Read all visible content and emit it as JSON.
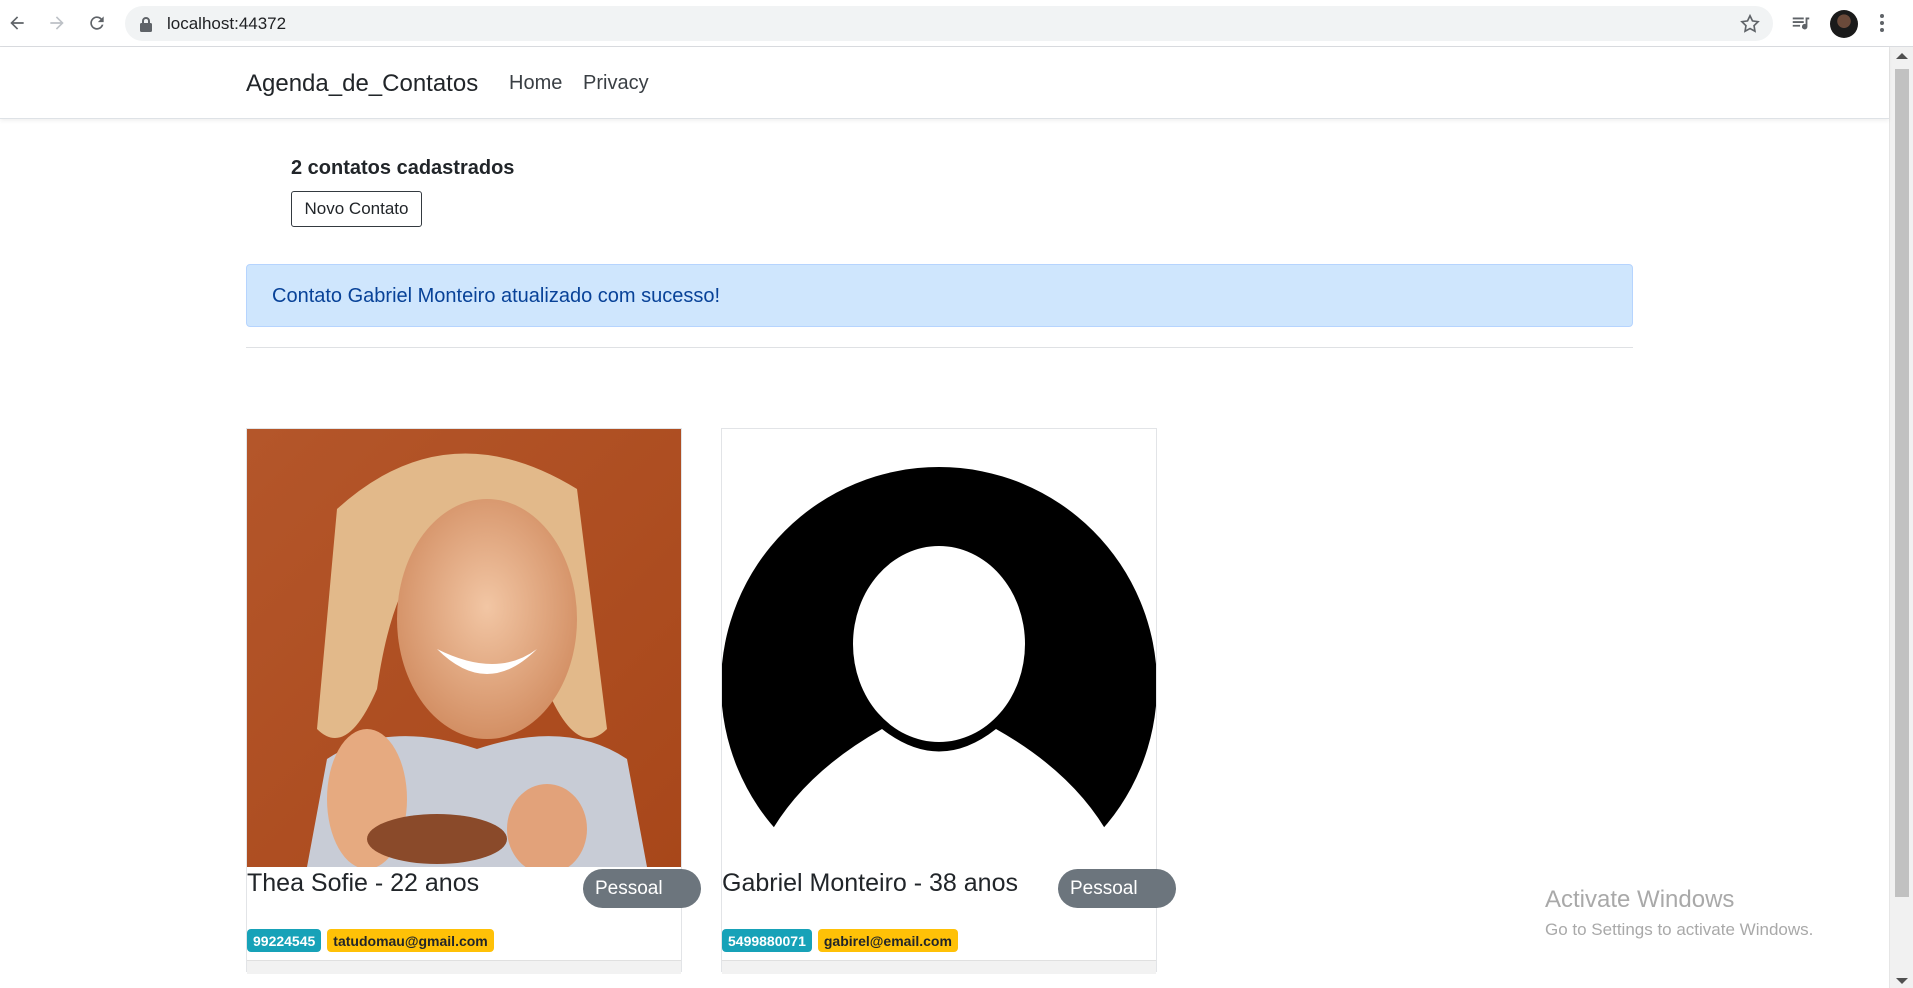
{
  "browser": {
    "url": "localhost:44372"
  },
  "navbar": {
    "brand": "Agenda_de_Contatos",
    "links": [
      "Home",
      "Privacy"
    ]
  },
  "main": {
    "count_title": "2 contatos cadastrados",
    "new_button": "Novo Contato",
    "alert": "Contato Gabriel Monteiro atualizado com sucesso!"
  },
  "contacts": [
    {
      "name": "Thea Sofie - 22 anos",
      "category": "Pessoal",
      "phone": "99224545",
      "email": "tatudomau@gmail.com",
      "photo": "portrait-photo"
    },
    {
      "name": "Gabriel Monteiro - 38 anos",
      "category": "Pessoal",
      "phone": "5499880071",
      "email": "gabirel@email.com",
      "photo": "default-avatar"
    }
  ],
  "watermark": {
    "title": "Activate Windows",
    "subtitle": "Go to Settings to activate Windows."
  },
  "colors": {
    "alert_bg": "#cfe6fd",
    "phone_badge": "#17a2b8",
    "email_badge": "#ffc107",
    "category_pill": "#6c757d"
  }
}
